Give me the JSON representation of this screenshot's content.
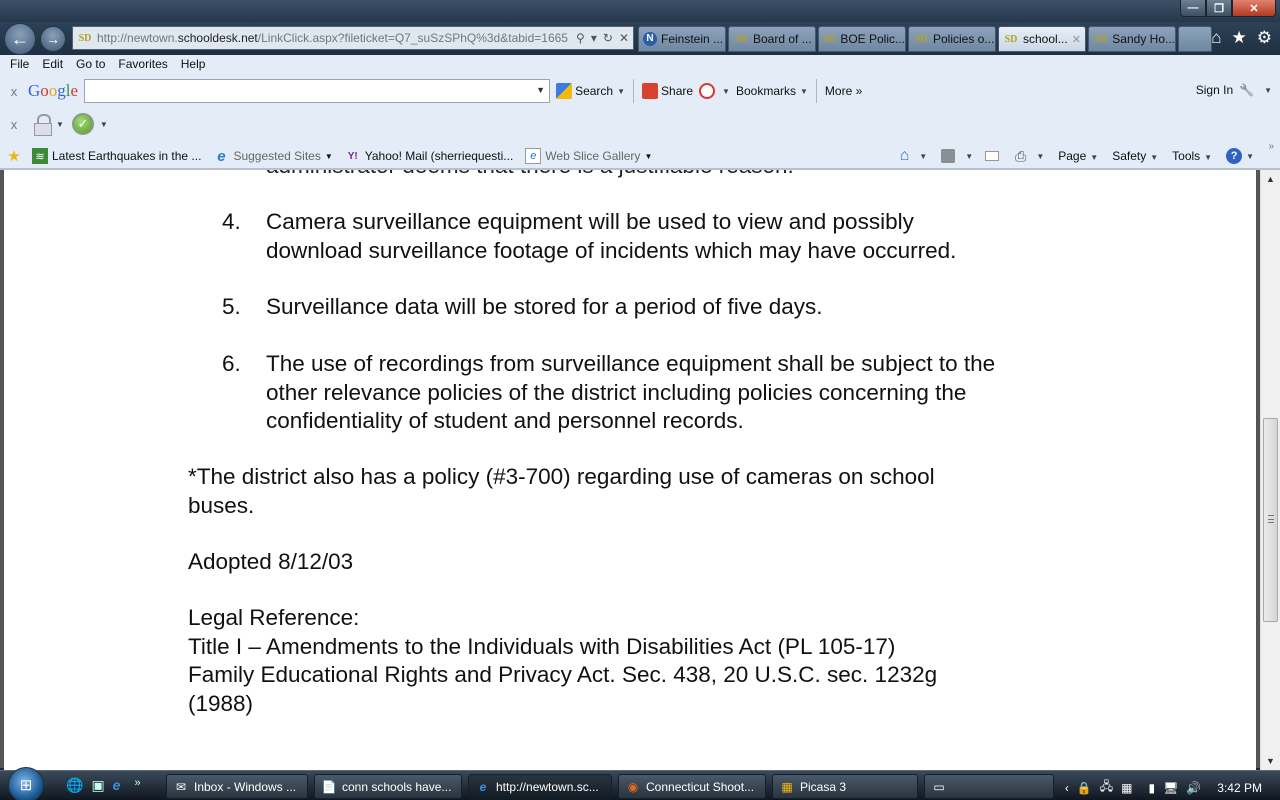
{
  "window": {
    "controls": {
      "minimize": "—",
      "restore": "❐",
      "close": "✕"
    }
  },
  "nav": {
    "back_icon": "←",
    "forward_icon": "→",
    "url_prefix": "http://newtown.",
    "url_domain": "schooldesk.net",
    "url_suffix": "/LinkClick.aspx?fileticket=Q7_suSzSPhQ%3d&tabid=1665",
    "site_icon_text": "SD",
    "search_icon": "⚲",
    "refresh_icon": "↻",
    "stop_icon": "✕"
  },
  "tabs": [
    {
      "label": "Feinstein ...",
      "icon": "N",
      "active": false
    },
    {
      "label": "Board of ...",
      "icon": "SD",
      "active": false
    },
    {
      "label": "BOE Polic...",
      "icon": "SD",
      "active": false
    },
    {
      "label": "Policies o...",
      "icon": "SD",
      "active": false
    },
    {
      "label": "school...",
      "icon": "SD",
      "active": true,
      "close": "✕"
    },
    {
      "label": "Sandy Ho...",
      "icon": "SD",
      "active": false
    }
  ],
  "right_nav": {
    "home": "⌂",
    "favorites": "★",
    "tools": "⚙"
  },
  "menu": [
    "File",
    "Edit",
    "Go to",
    "Favorites",
    "Help"
  ],
  "google_toolbar": {
    "close": "x",
    "logo": [
      "G",
      "o",
      "o",
      "g",
      "l",
      "e"
    ],
    "search_value": "",
    "search_label": "Search",
    "share_label": "Share",
    "bookmarks_label": "Bookmarks",
    "more_label": "More »",
    "sign_in_label": "Sign In",
    "wrench_icon": "🔧"
  },
  "addon_toolbar": {
    "close": "x",
    "check_icon": "✓"
  },
  "favorites_bar": {
    "items": [
      {
        "label": "Latest Earthquakes in the ...",
        "icon": "≋",
        "grey": false,
        "dropdown": false
      },
      {
        "label": "Suggested Sites",
        "icon": "e",
        "grey": true,
        "dropdown": true
      },
      {
        "label": "Yahoo! Mail (sherriequesti...",
        "icon": "Y!",
        "grey": false,
        "dropdown": false
      },
      {
        "label": "Web Slice Gallery",
        "icon": "e",
        "grey": true,
        "dropdown": true
      }
    ]
  },
  "command_bar": {
    "page": "Page",
    "safety": "Safety",
    "tools": "Tools",
    "help_icon": "?",
    "overflow": "»"
  },
  "document": {
    "cut_line": "administrator deems that there is a justifiable reason.",
    "items": [
      {
        "num": "4.",
        "lines": [
          "Camera surveillance equipment will be used to view and possibly",
          "download surveillance footage of incidents which may have occurred."
        ]
      },
      {
        "num": "5.",
        "lines": [
          "Surveillance data will be stored for a period of five days."
        ]
      },
      {
        "num": "6.",
        "lines": [
          "The use of recordings from surveillance equipment shall be subject to the",
          "other relevance policies of the district including policies concerning the",
          "confidentiality of student and personnel records."
        ]
      }
    ],
    "note_lines": [
      "*The district also has a policy (#3-700) regarding use of cameras on school",
      "buses."
    ],
    "adopted": "Adopted 8/12/03",
    "legal_heading": "Legal Reference:",
    "legal_lines": [
      "Title I – Amendments to the Individuals with Disabilities Act (PL 105-17)",
      "Family Educational Rights and Privacy Act. Sec. 438, 20 U.S.C. sec. 1232g",
      "(1988)"
    ]
  },
  "scrollbar": {
    "position_fraction": 0.55
  },
  "taskbar": {
    "start_icon": "⊞",
    "quicklaunch_overflow": "»",
    "buttons": [
      {
        "label": "Inbox - Windows ...",
        "icon": "✉",
        "active": false
      },
      {
        "label": "conn schools have...",
        "icon": "📄",
        "active": false
      },
      {
        "label": "http://newtown.sc...",
        "icon": "e",
        "active": true
      },
      {
        "label": "Connecticut Shoot...",
        "icon": "◉",
        "active": false
      },
      {
        "label": "Picasa 3",
        "icon": "▦",
        "active": false
      },
      {
        "label": "",
        "icon": "▭",
        "active": false
      }
    ],
    "tray_expand": "‹",
    "clock": "3:42 PM"
  }
}
